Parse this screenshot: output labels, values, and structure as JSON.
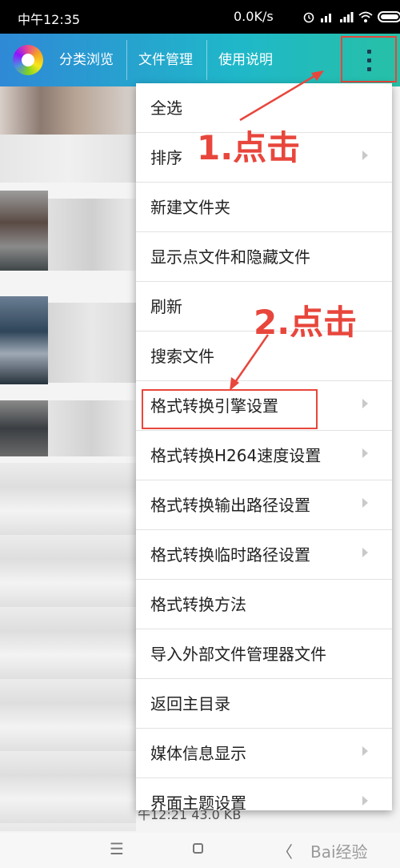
{
  "status_bar": {
    "time": "中午12:35",
    "network_speed": "0.0K/s"
  },
  "app_bar": {
    "tabs": [
      "分类浏览",
      "文件管理",
      "使用说明"
    ]
  },
  "menu": {
    "items": [
      {
        "label": "全选",
        "has_submenu": false
      },
      {
        "label": "排序",
        "has_submenu": true
      },
      {
        "label": "新建文件夹",
        "has_submenu": false
      },
      {
        "label": "显示点文件和隐藏文件",
        "has_submenu": false
      },
      {
        "label": "刷新",
        "has_submenu": false
      },
      {
        "label": "搜索文件",
        "has_submenu": false
      },
      {
        "label": "格式转换引擎设置",
        "has_submenu": true
      },
      {
        "label": "格式转换H264速度设置",
        "has_submenu": true
      },
      {
        "label": "格式转换输出路径设置",
        "has_submenu": true
      },
      {
        "label": "格式转换临时路径设置",
        "has_submenu": true
      },
      {
        "label": "格式转换方法",
        "has_submenu": false
      },
      {
        "label": "导入外部文件管理器文件",
        "has_submenu": false
      },
      {
        "label": "返回主目录",
        "has_submenu": false
      },
      {
        "label": "媒体信息显示",
        "has_submenu": true
      },
      {
        "label": "界面主题设置",
        "has_submenu": true
      }
    ]
  },
  "annotations": {
    "step1": "1.点击",
    "step2": "2.点击"
  },
  "background": {
    "file_info": "午12:21   43.0 KB"
  },
  "nav_bar": {
    "menu_glyph": "☰",
    "back_glyph": "〈",
    "watermark": "Bai经验"
  },
  "colors": {
    "annotation_red": "#e8463c",
    "app_bar_start": "#2f89d6",
    "app_bar_end": "#27c0a6",
    "menu_text": "#222222"
  }
}
